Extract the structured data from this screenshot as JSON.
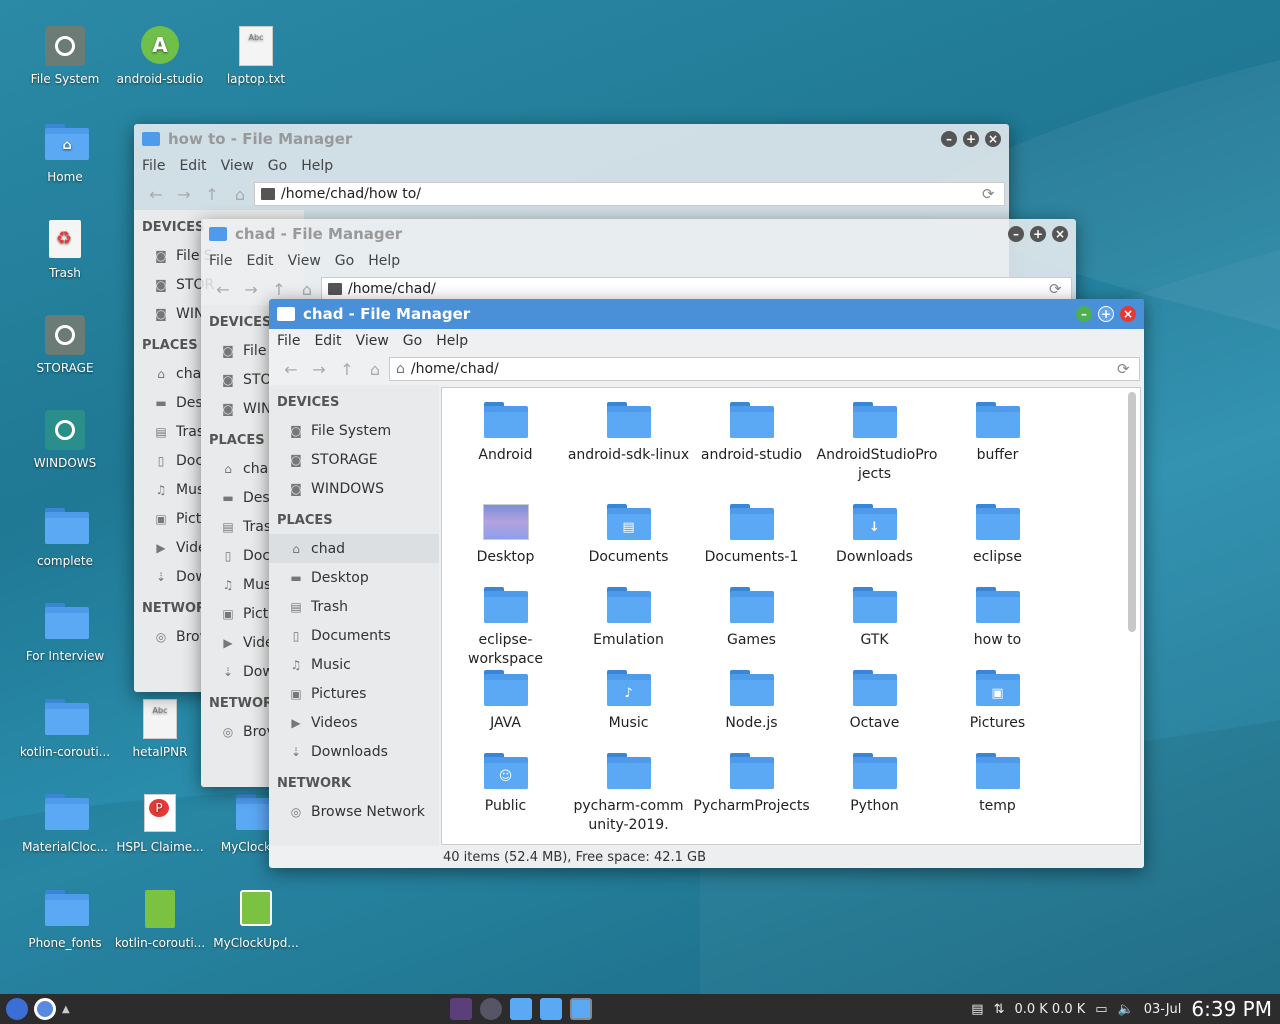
{
  "desktop": {
    "icons": [
      {
        "label": "File System"
      },
      {
        "label": "android-studio"
      },
      {
        "label": "laptop.txt"
      },
      {
        "label": "Home"
      },
      {
        "label": "Trash"
      },
      {
        "label": "STORAGE"
      },
      {
        "label": "WINDOWS"
      },
      {
        "label": "complete"
      },
      {
        "label": "For Interview"
      },
      {
        "label": "kotlin-corouti..."
      },
      {
        "label": "hetalPNR"
      },
      {
        "label": "MaterialCloc..."
      },
      {
        "label": "HSPL Claime..."
      },
      {
        "label": "MyClockU..."
      },
      {
        "label": "Phone_fonts"
      },
      {
        "label": "kotlin-corouti..."
      },
      {
        "label": "MyClockUpd..."
      }
    ]
  },
  "window_back": {
    "title": "how to - File Manager",
    "path": "/home/chad/how to/",
    "devices_header": "DEVICES",
    "places_header": "PLACES",
    "network_header": "NETWOR",
    "items": [
      "File S",
      "STOR",
      "WIN",
      "chac",
      "Desl",
      "Tras",
      "Doc",
      "Mus",
      "Pictu",
      "Vide",
      "Dow",
      "Brow"
    ]
  },
  "window_mid": {
    "title": "chad - File Manager",
    "path": "/home/chad/",
    "devices_header": "DEVICES",
    "places_header": "PLACES",
    "network_header": "NETWOR",
    "items": [
      "File S",
      "STOI",
      "WIN",
      "chad",
      "Desk",
      "Trasl",
      "Docu",
      "Mus",
      "Pictu",
      "Vide",
      "Dow",
      "Brov"
    ]
  },
  "window_front": {
    "title": "chad - File Manager",
    "menu": [
      "File",
      "Edit",
      "View",
      "Go",
      "Help"
    ],
    "path": "/home/chad/",
    "sidebar": {
      "devices_header": "DEVICES",
      "devices": [
        "File System",
        "STORAGE",
        "WINDOWS"
      ],
      "places_header": "PLACES",
      "places": [
        "chad",
        "Desktop",
        "Trash",
        "Documents",
        "Music",
        "Pictures",
        "Videos",
        "Downloads"
      ],
      "network_header": "NETWORK",
      "network": [
        "Browse Network"
      ]
    },
    "files": [
      "Android",
      "android-sdk-linux",
      "android-studio",
      "AndroidStudioPro jects",
      "buffer",
      "Desktop",
      "Documents",
      "Documents-1",
      "Downloads",
      "eclipse",
      "eclipse-workspace",
      "Emulation",
      "Games",
      "GTK",
      "how to",
      "JAVA",
      "Music",
      "Node.js",
      "Octave",
      "Pictures",
      "Public",
      "pycharm-community-2019.",
      "PycharmProjects",
      "Python",
      "temp"
    ],
    "status": "40 items (52.4 MB), Free space: 42.1 GB"
  },
  "taskbar": {
    "net_speed": "0.0 K 0.0 K",
    "date": "03-Jul",
    "time": "6:39 PM"
  },
  "colors": {
    "accent": "#4a90d9",
    "folder": "#5ba8f5",
    "desktop_bg": "#2083a0",
    "taskbar": "#2c2c2c"
  }
}
